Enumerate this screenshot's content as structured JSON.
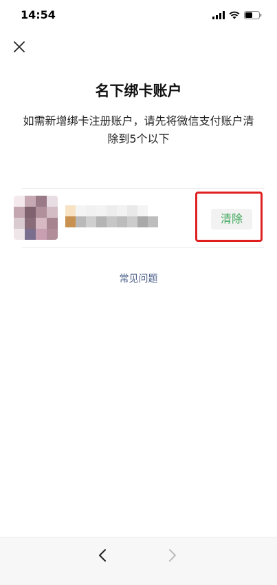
{
  "status_bar": {
    "time": "14:54"
  },
  "page": {
    "title": "名下绑卡账户",
    "description": "如需新增绑卡注册账户，请先将微信支付账户清除到5个以下"
  },
  "account": {
    "clear_label": "清除"
  },
  "faq": {
    "label": "常见问题"
  },
  "colors": {
    "accent_green": "#3fa85b",
    "link_blue": "#4a5d88",
    "highlight_red": "#e02020"
  }
}
